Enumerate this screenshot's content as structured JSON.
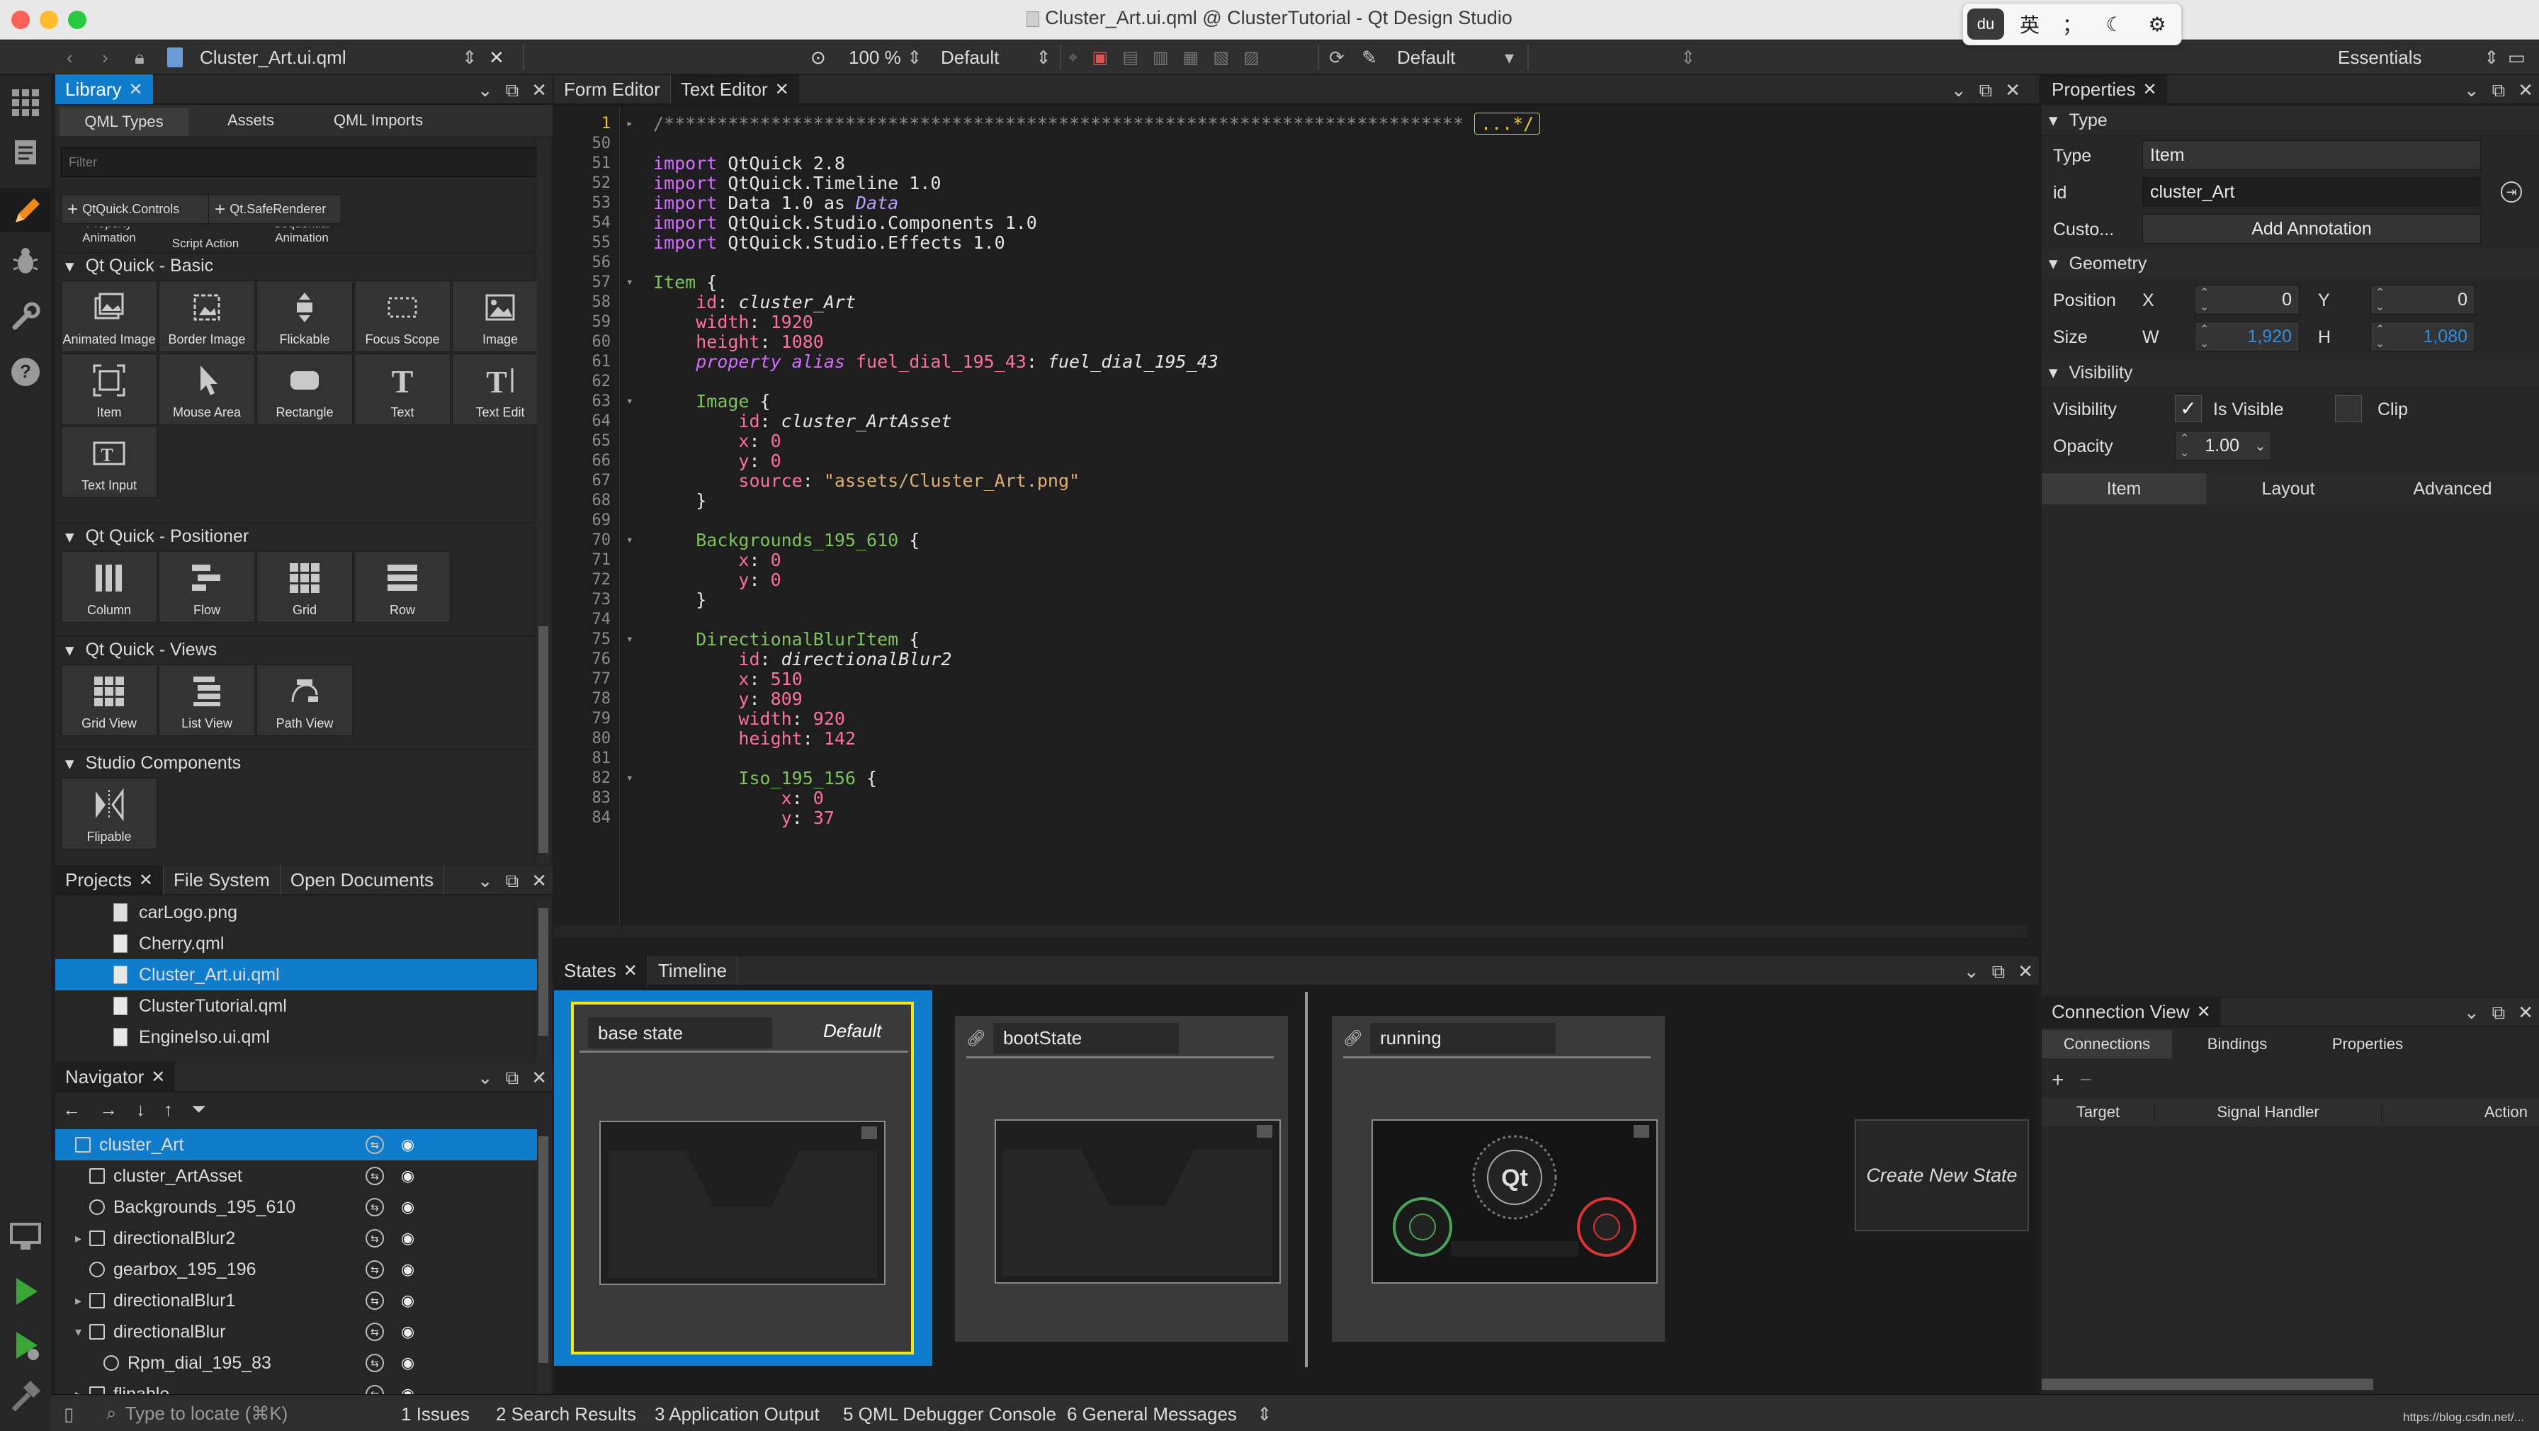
{
  "window": {
    "title": "Cluster_Art.ui.qml @ ClusterTutorial - Qt Design Studio",
    "ime_items": [
      "英",
      "；",
      "☾",
      "⚙"
    ]
  },
  "toolbar": {
    "file_name": "Cluster_Art.ui.qml",
    "zoom": "100 %",
    "style": "Default",
    "state": "Default",
    "workspace": "Essentials"
  },
  "library": {
    "tab": "Library",
    "subtabs": [
      "QML Types",
      "Assets",
      "QML Imports"
    ],
    "filter_placeholder": "Filter",
    "import_buttons": [
      "QtQuick.Controls",
      "Qt.SafeRenderer"
    ],
    "partial_row": [
      "Property Animation",
      "Script Action",
      "Sequential Animation"
    ],
    "sections": [
      "Qt Quick - Basic",
      "Qt Quick - Positioner",
      "Qt Quick - Views",
      "Studio Components"
    ],
    "basic": [
      "Animated Image",
      "Border Image",
      "Flickable",
      "Focus Scope",
      "Image",
      "Item",
      "Mouse Area",
      "Rectangle",
      "Text",
      "Text Edit",
      "Text Input"
    ],
    "positioner": [
      "Column",
      "Flow",
      "Grid",
      "Row"
    ],
    "views": [
      "Grid View",
      "List View",
      "Path View"
    ],
    "studio": [
      "Flipable"
    ]
  },
  "projects": {
    "tabs": [
      "Projects",
      "File System",
      "Open Documents"
    ],
    "files": [
      "carLogo.png",
      "Cherry.qml",
      "Cluster_Art.ui.qml",
      "ClusterTutorial.qml",
      "EngineIso.ui.qml"
    ]
  },
  "navigator": {
    "tab": "Navigator",
    "items": [
      "cluster_Art",
      "cluster_ArtAsset",
      "Backgrounds_195_610",
      "directionalBlur2",
      "gearbox_195_196",
      "directionalBlur1",
      "directionalBlur",
      "Rpm_dial_195_83",
      "flipable"
    ]
  },
  "editor": {
    "tabs": [
      "Form Editor",
      "Text Editor"
    ],
    "lines": [
      {
        "n": "1",
        "t": "/***************************************************************************  ...*/"
      },
      {
        "n": "50",
        "t": ""
      },
      {
        "n": "51",
        "t": "import QtQuick 2.8"
      },
      {
        "n": "52",
        "t": "import QtQuick.Timeline 1.0"
      },
      {
        "n": "53",
        "t": "import Data 1.0 as Data"
      },
      {
        "n": "54",
        "t": "import QtQuick.Studio.Components 1.0"
      },
      {
        "n": "55",
        "t": "import QtQuick.Studio.Effects 1.0"
      },
      {
        "n": "56",
        "t": ""
      },
      {
        "n": "57",
        "t": "Item {"
      },
      {
        "n": "58",
        "t": "    id: cluster_Art"
      },
      {
        "n": "59",
        "t": "    width: 1920"
      },
      {
        "n": "60",
        "t": "    height: 1080"
      },
      {
        "n": "61",
        "t": "    property alias fuel_dial_195_43: fuel_dial_195_43"
      },
      {
        "n": "62",
        "t": ""
      },
      {
        "n": "63",
        "t": "    Image {"
      },
      {
        "n": "64",
        "t": "        id: cluster_ArtAsset"
      },
      {
        "n": "65",
        "t": "        x: 0"
      },
      {
        "n": "66",
        "t": "        y: 0"
      },
      {
        "n": "67",
        "t": "        source: \"assets/Cluster_Art.png\""
      },
      {
        "n": "68",
        "t": "    }"
      },
      {
        "n": "69",
        "t": ""
      },
      {
        "n": "70",
        "t": "    Backgrounds_195_610 {"
      },
      {
        "n": "71",
        "t": "        x: 0"
      },
      {
        "n": "72",
        "t": "        y: 0"
      },
      {
        "n": "73",
        "t": "    }"
      },
      {
        "n": "74",
        "t": ""
      },
      {
        "n": "75",
        "t": "    DirectionalBlurItem {"
      },
      {
        "n": "76",
        "t": "        id: directionalBlur2"
      },
      {
        "n": "77",
        "t": "        x: 510"
      },
      {
        "n": "78",
        "t": "        y: 809"
      },
      {
        "n": "79",
        "t": "        width: 920"
      },
      {
        "n": "80",
        "t": "        height: 142"
      },
      {
        "n": "81",
        "t": ""
      },
      {
        "n": "82",
        "t": "        Iso_195_156 {"
      },
      {
        "n": "83",
        "t": "            x: 0"
      },
      {
        "n": "84",
        "t": "            y: 37"
      }
    ]
  },
  "states": {
    "tabs": [
      "States",
      "Timeline"
    ],
    "cards": [
      {
        "name": "base state",
        "tag": "Default"
      },
      {
        "name": "bootState",
        "tag": ""
      },
      {
        "name": "running",
        "tag": ""
      }
    ],
    "create": "Create New State"
  },
  "properties": {
    "tab": "Properties",
    "type_section": "Type",
    "type_label": "Type",
    "type_value": "Item",
    "id_label": "id",
    "id_value": "cluster_Art",
    "custom_label": "Custo...",
    "annotation_button": "Add Annotation",
    "geometry_section": "Geometry",
    "position_label": "Position",
    "x_label": "X",
    "x_value": "0",
    "y_label": "Y",
    "y_value": "0",
    "size_label": "Size",
    "w_label": "W",
    "w_value": "1,920",
    "h_label": "H",
    "h_value": "1,080",
    "visibility_section": "Visibility",
    "visibility_label": "Visibility",
    "is_visible": "Is Visible",
    "clip": "Clip",
    "opacity_label": "Opacity",
    "opacity_value": "1.00",
    "subtabs": [
      "Item",
      "Layout",
      "Advanced"
    ]
  },
  "connections": {
    "tab": "Connection View",
    "subtabs": [
      "Connections",
      "Bindings",
      "Properties"
    ],
    "columns": [
      "Target",
      "Signal Handler",
      "Action"
    ]
  },
  "statusbar": {
    "locate_placeholder": "Type to locate (⌘K)",
    "items": [
      "1  Issues",
      "2  Search Results",
      "3  Application Output",
      "5  QML Debugger Console",
      "6  General Messages"
    ],
    "watermark": "https://blog.csdn.net/..."
  }
}
